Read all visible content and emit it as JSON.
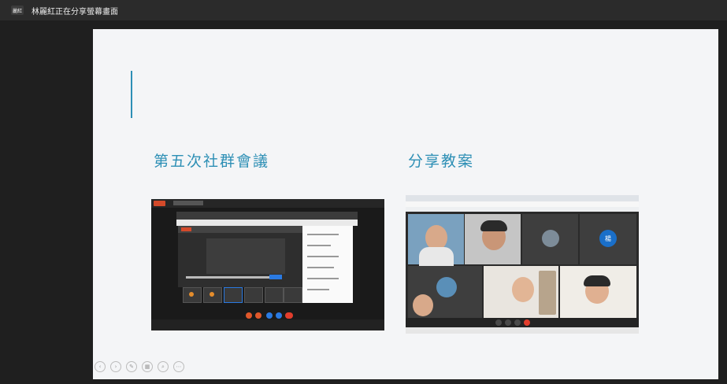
{
  "topbar": {
    "presenter_badge": "麗紅",
    "share_status": "林麗紅正在分享螢幕畫面"
  },
  "slide": {
    "heading_left": "第五次社群會議",
    "heading_right": "分享教案"
  },
  "mini_screen_right": {
    "avatar_letter": "楊"
  },
  "colors": {
    "accent": "#2d8fb5",
    "slide_bg": "#f4f5f7",
    "background": "#1f1f1f",
    "end_call_red": "#e23d2c"
  }
}
